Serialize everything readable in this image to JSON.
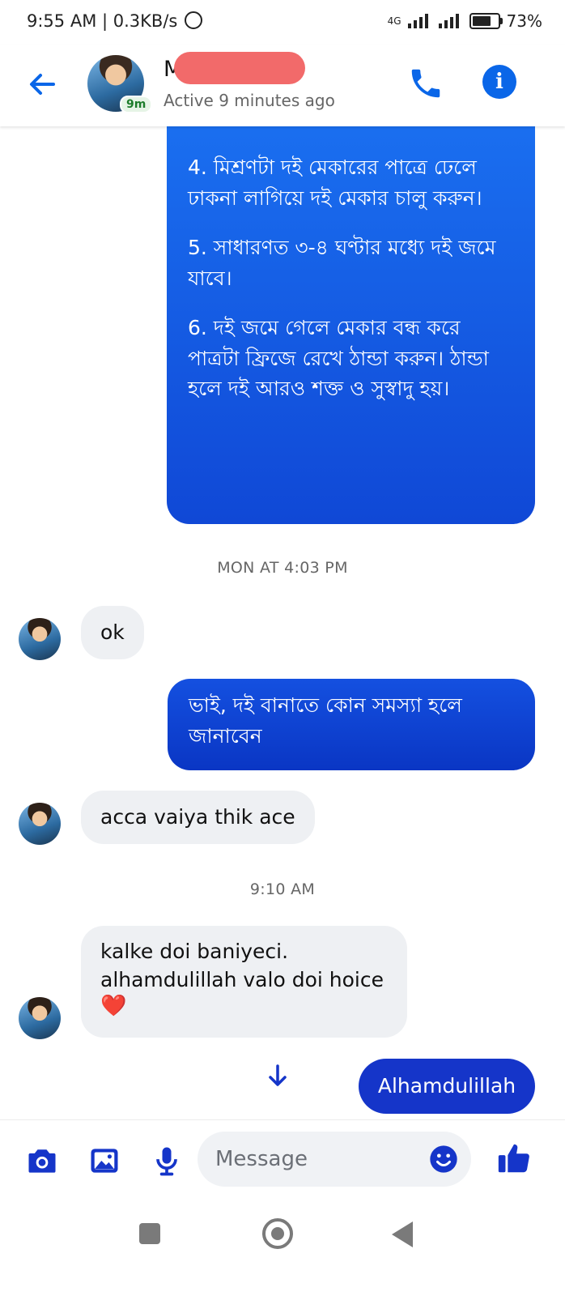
{
  "status_bar": {
    "left_text": "9:55 AM | 0.3KB/s",
    "network": "4G",
    "battery": "73%"
  },
  "header": {
    "name": "M                 med",
    "active_badge": "9m",
    "status": "Active 9 minutes ago"
  },
  "messages": {
    "long_out": {
      "paragraphs": [
        "4. মিশ্রণটা দই মেকারের পাত্রে ঢেলে ঢাকনা লাগিয়ে দই মেকার চালু করুন।",
        "5. সাধারণত ৩-৪ ঘণ্টার মধ্যে দই জমে যাবে।",
        "6. দই জমে গেলে মেকার বন্ধ করে পাত্রটা ফ্রিজে রেখে ঠান্ডা করুন। ঠান্ডা হলে দই আরও শক্ত ও সুস্বাদু হয়।"
      ]
    },
    "timestamp1": "MON AT 4:03 PM",
    "in1": "ok",
    "out2": "ভাই, দই বানাতে কোন সমস্যা হলে জানাবেন",
    "in2": "acca vaiya thik ace",
    "timestamp2": "9:10 AM",
    "in3_line1": "kalke doi baniyeci.",
    "in3_line2": "alhamdulillah valo doi hoice",
    "in3_emoji": "❤️",
    "quick_reply": "Alhamdulillah"
  },
  "composer": {
    "placeholder": "Message"
  },
  "colors": {
    "accent": "#0a66e8",
    "bubble_out": "#1048d6",
    "chip": "#1535c9",
    "bubble_in": "#eef0f3"
  },
  "icons": [
    "back-arrow-icon",
    "phone-icon",
    "info-icon",
    "camera-icon",
    "image-icon",
    "microphone-icon",
    "emoji-icon",
    "like-icon",
    "arrow-down-icon"
  ]
}
